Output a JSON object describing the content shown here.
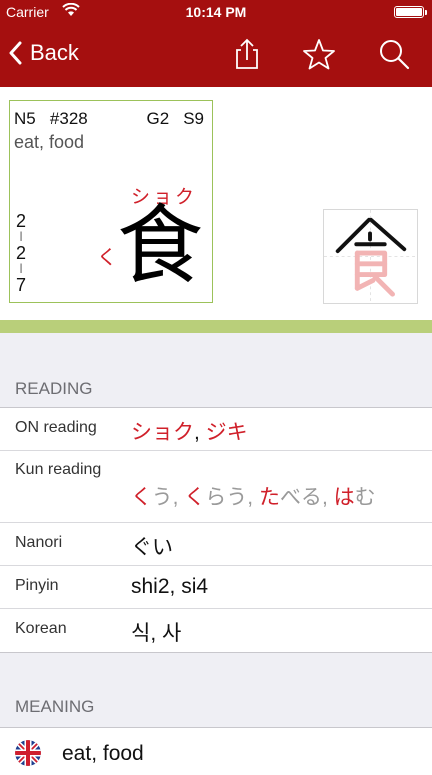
{
  "status": {
    "carrier": "Carrier",
    "time": "10:14 PM"
  },
  "nav": {
    "back_label": "Back"
  },
  "card": {
    "jlpt": "N5",
    "number": "#328",
    "grade": "G2",
    "strokes": "S9",
    "meaning": "eat, food",
    "on_reading": "ショク",
    "kun_reading": "く",
    "kanji": "食",
    "freq": [
      "2",
      "2",
      "7"
    ]
  },
  "sections": {
    "reading_header": "READING",
    "meaning_header": "MEANING"
  },
  "reading": {
    "on_label": "ON reading",
    "on_value": [
      "ショク",
      ", ",
      "ジキ"
    ],
    "kun_label": "Kun reading",
    "kun_value": [
      {
        "red": "く",
        "gray": "う"
      },
      {
        "red": "く",
        "gray": "らう"
      },
      {
        "red": "た",
        "gray": "べる"
      },
      {
        "red": "は",
        "gray": "む"
      }
    ],
    "nanori_label": "Nanori",
    "nanori_value": "ぐい",
    "pinyin_label": "Pinyin",
    "pinyin_value": "shi2, si4",
    "korean_label": "Korean",
    "korean_value": "식, 사"
  },
  "meaning_row": {
    "text": "eat, food",
    "flag": "uk-flag-icon"
  },
  "colors": {
    "nav": "#a50f0f",
    "accent": "#d0202a",
    "card_border": "#9cc25a",
    "green_bar": "#b9cf7a"
  }
}
